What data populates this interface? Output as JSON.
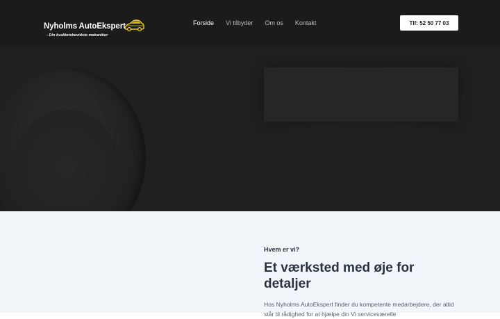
{
  "brand": {
    "name": "Nyholms AutoEkspert",
    "tagline": "- Din kvalitetsbevidste mekaniker"
  },
  "nav": {
    "items": [
      {
        "label": "Forside",
        "active": true
      },
      {
        "label": "Vi tilbyder",
        "active": false
      },
      {
        "label": "Om os",
        "active": false
      },
      {
        "label": "Kontakt",
        "active": false
      }
    ]
  },
  "header": {
    "phone_label": "Tlf: 52 50 77 03"
  },
  "about": {
    "eyebrow": "Hvem er vi?",
    "title": "Et værksted med øje for detaljer",
    "text": "Hos Nyholms AutoEkspert finder du kompetente medarbejdere, der altid står til rådighed for at hjælpe din Vi serviceværelle"
  },
  "colors": {
    "header_bg": "#1b1b1b",
    "hero_bg": "#202020",
    "about_bg": "#f2f6fa",
    "logo_accent": "#f2d21b",
    "heading": "#2a3140"
  },
  "icons": {
    "logo_car": "car-icon"
  }
}
